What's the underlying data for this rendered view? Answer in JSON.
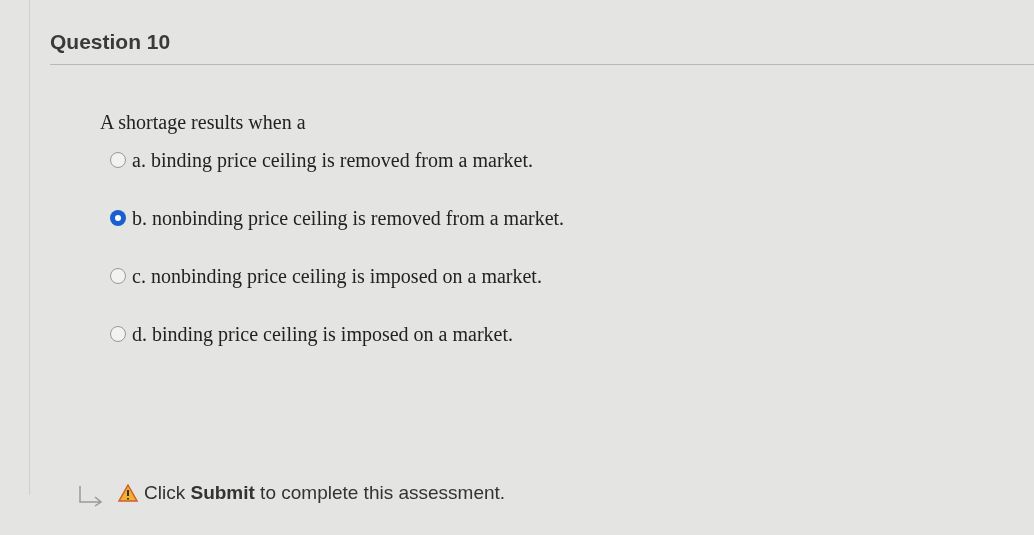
{
  "question": {
    "title": "Question 10",
    "prompt": "A shortage results when a",
    "options": [
      {
        "letter": "a.",
        "text": "binding price ceiling is removed from a market.",
        "selected": false
      },
      {
        "letter": "b.",
        "text": "nonbinding price ceiling is removed from a market.",
        "selected": true
      },
      {
        "letter": "c.",
        "text": "nonbinding price ceiling is imposed on a market.",
        "selected": false
      },
      {
        "letter": "d.",
        "text": "binding price ceiling is imposed on a market.",
        "selected": false
      }
    ]
  },
  "notice": {
    "text": "Click **Submit** to complete this assessment."
  }
}
